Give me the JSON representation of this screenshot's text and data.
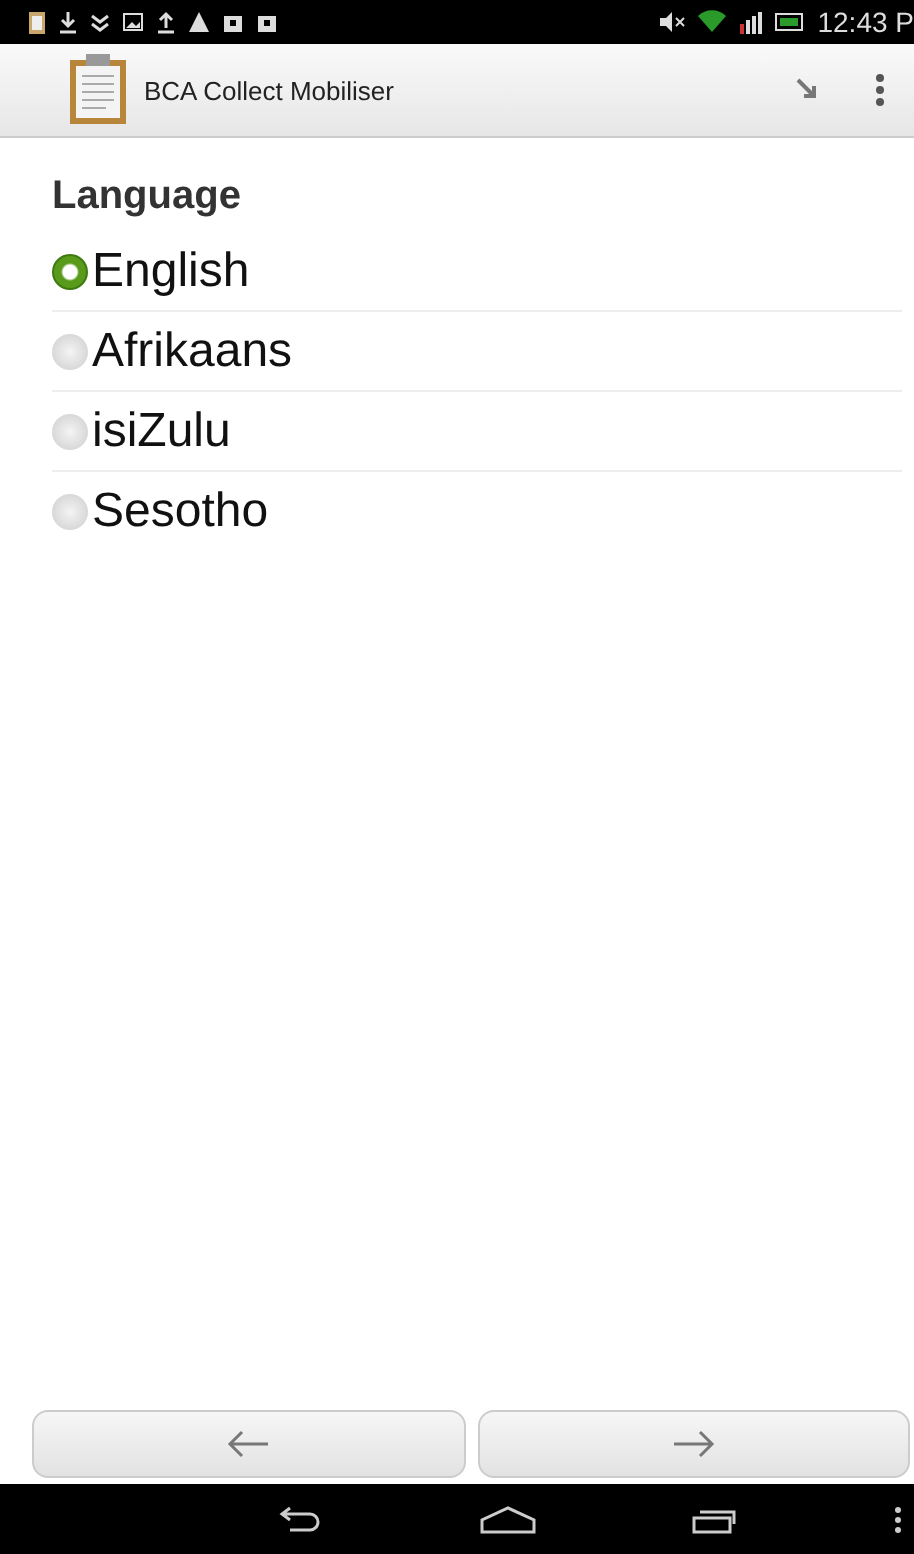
{
  "status_bar": {
    "time": "12:43 P"
  },
  "action_bar": {
    "title": "BCA Collect Mobiliser"
  },
  "question": {
    "label": "Language",
    "options": [
      {
        "label": "English",
        "selected": true
      },
      {
        "label": "Afrikaans",
        "selected": false
      },
      {
        "label": "isiZulu",
        "selected": false
      },
      {
        "label": "Sesotho",
        "selected": false
      }
    ]
  }
}
